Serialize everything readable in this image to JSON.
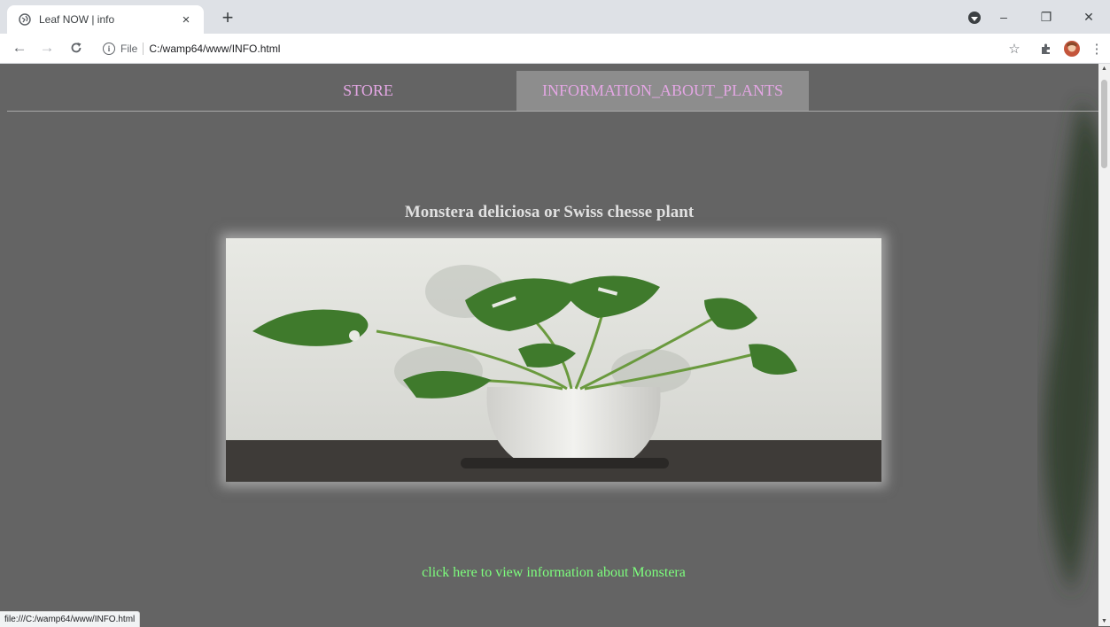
{
  "browser": {
    "tab": {
      "title": "Leaf NOW | info",
      "close": "×"
    },
    "new_tab": "+",
    "window": {
      "minimize": "–",
      "restore": "❐",
      "close": "✕"
    },
    "address": {
      "scheme": "File",
      "url": "C:/wamp64/www/INFO.html"
    },
    "status_url": "file:///C:/wamp64/www/INFO.html"
  },
  "site": {
    "nav": [
      {
        "label": "STORE"
      },
      {
        "label": "INFORMATION_ABOUT_PLANTS"
      }
    ],
    "heading": "Monstera deliciosa or Swiss chesse plant",
    "link_text": "click here to view information about Monstera"
  },
  "colors": {
    "page_bg": "#646464",
    "nav_text": "#e3a6e3",
    "active_nav_bg": "#8d8d8d",
    "link": "#7dff7d"
  }
}
